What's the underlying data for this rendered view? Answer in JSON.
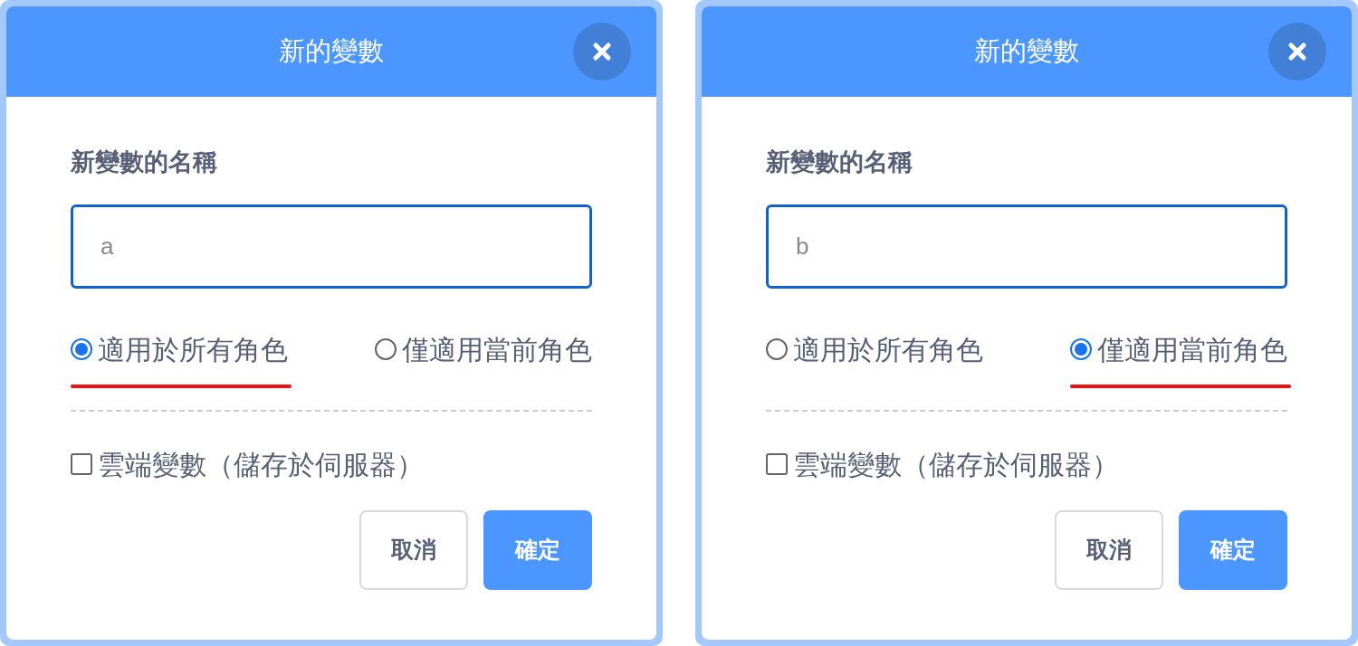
{
  "dialogs": [
    {
      "title": "新的變數",
      "name_label": "新變數的名稱",
      "name_value": "a",
      "scope_options": [
        {
          "label": "適用於所有角色",
          "selected": true
        },
        {
          "label": "僅適用當前角色",
          "selected": false
        }
      ],
      "cloud": {
        "label": "雲端變數（儲存於伺服器）",
        "checked": false
      },
      "buttons": [
        {
          "label": "取消",
          "kind": "cancel"
        },
        {
          "label": "確定",
          "kind": "ok"
        }
      ]
    },
    {
      "title": "新的變數",
      "name_label": "新變數的名稱",
      "name_value": "b",
      "scope_options": [
        {
          "label": "適用於所有角色",
          "selected": false
        },
        {
          "label": "僅適用當前角色",
          "selected": true
        }
      ],
      "cloud": {
        "label": "雲端變數（儲存於伺服器）",
        "checked": false
      },
      "buttons": [
        {
          "label": "取消",
          "kind": "cancel"
        },
        {
          "label": "確定",
          "kind": "ok"
        }
      ]
    }
  ]
}
